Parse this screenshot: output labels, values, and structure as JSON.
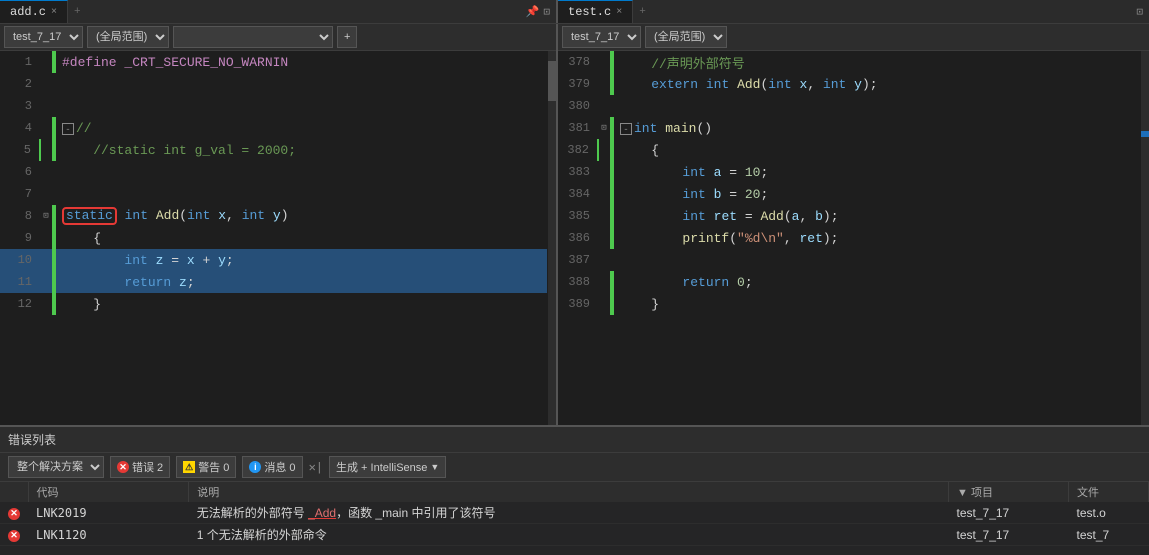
{
  "tabs": {
    "left": [
      {
        "label": "add.c",
        "active": true,
        "close": "×"
      },
      {
        "label": "+",
        "active": false
      }
    ],
    "right": [
      {
        "label": "test.c",
        "active": true,
        "close": "×"
      },
      {
        "label": "+",
        "active": false
      }
    ]
  },
  "left_toolbar": {
    "scope_select": "test_7_17",
    "scope_select2": "(全局范围)",
    "scope_select3": ""
  },
  "right_toolbar": {
    "scope_select": "test_7_17",
    "scope_select2": "(全局范围)"
  },
  "left_code": {
    "lines": [
      {
        "num": 1,
        "content": "#define _CRT_SECURE_NO_WARNIN",
        "type": "macro",
        "green": true
      },
      {
        "num": 2,
        "content": "",
        "type": "normal",
        "green": false
      },
      {
        "num": 3,
        "content": "",
        "type": "normal",
        "green": false
      },
      {
        "num": 4,
        "content": "//",
        "type": "comment_collapse",
        "green": true
      },
      {
        "num": 5,
        "content": "    //static int g_val = 2000;",
        "type": "comment",
        "green": true
      },
      {
        "num": 6,
        "content": "",
        "type": "normal",
        "green": false
      },
      {
        "num": 7,
        "content": "",
        "type": "normal",
        "green": false
      },
      {
        "num": 8,
        "content": "static int Add(int x, int y)",
        "type": "function_def",
        "green": true
      },
      {
        "num": 9,
        "content": "    {",
        "type": "normal",
        "green": true
      },
      {
        "num": 10,
        "content": "        int z = x + y;",
        "type": "selected",
        "green": true
      },
      {
        "num": 11,
        "content": "        return z;",
        "type": "selected",
        "green": true
      },
      {
        "num": 12,
        "content": "    }",
        "type": "normal",
        "green": true
      }
    ]
  },
  "right_code": {
    "lines": [
      {
        "num": 378,
        "content": "    //声明外部符号",
        "type": "comment",
        "green": true
      },
      {
        "num": 379,
        "content": "    extern int Add(int x, int y);",
        "type": "extern",
        "green": true
      },
      {
        "num": 380,
        "content": "",
        "type": "normal",
        "green": false
      },
      {
        "num": 381,
        "content": "int main()",
        "type": "function_def",
        "green": true
      },
      {
        "num": 382,
        "content": "    {",
        "type": "normal",
        "green": true
      },
      {
        "num": 383,
        "content": "        int a = 10;",
        "type": "normal",
        "green": true
      },
      {
        "num": 384,
        "content": "        int b = 20;",
        "type": "normal",
        "green": true
      },
      {
        "num": 385,
        "content": "        int ret = Add(a, b);",
        "type": "normal",
        "green": true
      },
      {
        "num": 386,
        "content": "        printf(\"%d\\n\", ret);",
        "type": "normal",
        "green": true
      },
      {
        "num": 387,
        "content": "",
        "type": "normal",
        "green": false
      },
      {
        "num": 388,
        "content": "        return 0;",
        "type": "normal",
        "green": true
      },
      {
        "num": 389,
        "content": "    }",
        "type": "normal",
        "green": true
      }
    ]
  },
  "error_panel": {
    "title": "错误列表",
    "scope_label": "整个解决方案",
    "errors_btn": "错误 2",
    "warnings_btn": "警告 0",
    "messages_btn": "消息 0",
    "build_btn": "生成 + IntelliSense",
    "columns": [
      "代码",
      "说明",
      "项目",
      "文件"
    ],
    "rows": [
      {
        "type": "error",
        "code": "LNK2019",
        "desc": "无法解析的外部符号 _Add，函数 _main 中引用了该符号",
        "project": "test_7_17",
        "file": "test.o"
      },
      {
        "type": "error",
        "code": "LNK1120",
        "desc": "1 个无法解析的外部命令",
        "project": "test_7_17",
        "file": "test_7"
      }
    ]
  }
}
